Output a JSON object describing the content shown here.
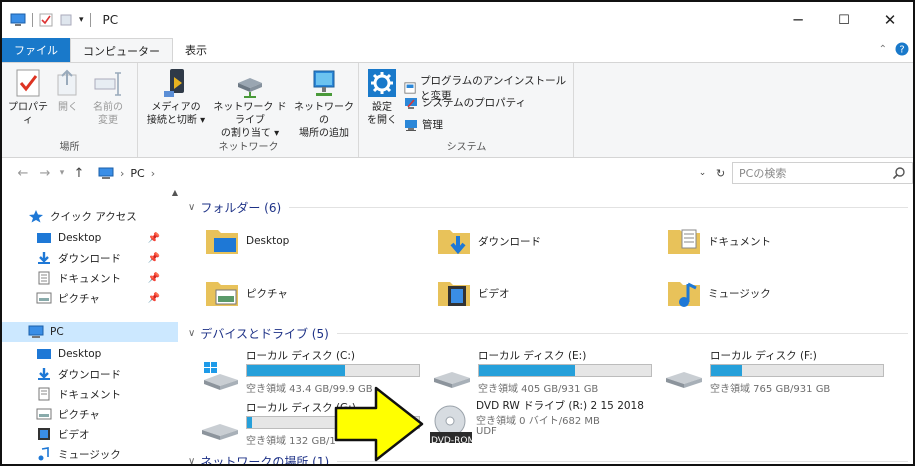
{
  "window": {
    "title": "PC",
    "minimize": "─",
    "maximize": "☐",
    "close": "✕"
  },
  "ribbon_tabs": [
    "ファイル",
    "コンピューター",
    "表示"
  ],
  "ribbon": {
    "location": {
      "label": "場所",
      "properties": "プロパティ",
      "open": "開く",
      "rename_1": "名前の",
      "rename_2": "変更"
    },
    "network": {
      "label": "ネットワーク",
      "media_1": "メディアの",
      "media_2": "接続と切断",
      "map_1": "ネットワーク ドライブ",
      "map_2": "の割り当て",
      "add_1": "ネットワークの",
      "add_2": "場所の追加"
    },
    "system": {
      "label": "システム",
      "settings_1": "設定",
      "settings_2": "を開く",
      "uninstall": "プログラムのアンインストールと変更",
      "sys_props": "システムのプロパティ",
      "manage": "管理"
    }
  },
  "address": {
    "path": "PC",
    "search_placeholder": "PCの検索"
  },
  "nav_pane": {
    "quick_access": "クイック アクセス",
    "qa_items": [
      "Desktop",
      "ダウンロード",
      "ドキュメント",
      "ピクチャ"
    ],
    "pc": "PC",
    "pc_items": [
      "Desktop",
      "ダウンロード",
      "ドキュメント",
      "ピクチャ",
      "ビデオ",
      "ミュージック"
    ]
  },
  "folders_section": "フォルダー (6)",
  "folders": [
    "Desktop",
    "ダウンロード",
    "ドキュメント",
    "ピクチャ",
    "ビデオ",
    "ミュージック"
  ],
  "devices_section": "デバイスとドライブ (5)",
  "drives": [
    {
      "name": "ローカル ディスク (C:)",
      "space": "空き領域 43.4 GB/99.9 GB",
      "used": 0.57
    },
    {
      "name": "ローカル ディスク (E:)",
      "space": "空き領域 405 GB/931 GB",
      "used": 0.56
    },
    {
      "name": "ローカル ディスク (F:)",
      "space": "空き領域 765 GB/931 GB",
      "used": 0.18
    },
    {
      "name": "ローカル ディスク (G:)",
      "space": "空き領域 132 GB/1",
      "used": 0.03
    },
    {
      "name": "DVD RW ドライブ (R:) 2 15 2018",
      "space": "空き領域 0 バイト/682 MB",
      "fs": "UDF",
      "badge": "DVD-ROM"
    }
  ],
  "network_section": "ネットワークの場所 (1)",
  "colors": {
    "file_tab": "#1979ca",
    "section": "#1e3287",
    "bar": "#26a0da",
    "arrow": "#ffff00"
  }
}
